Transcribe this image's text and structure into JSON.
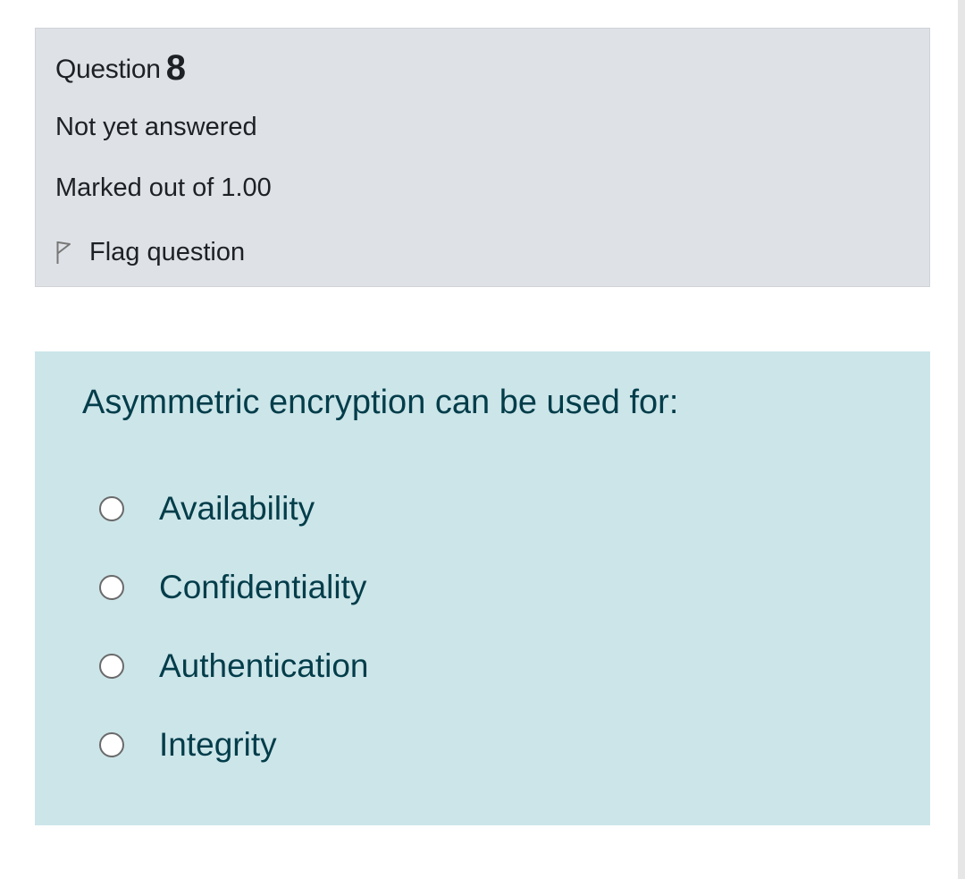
{
  "question_info": {
    "label": "Question",
    "number": "8",
    "state": "Not yet answered",
    "grade": "Marked out of 1.00",
    "flag_label": "Flag question"
  },
  "question": {
    "text": "Asymmetric encryption can be used for:",
    "answers": [
      {
        "label": "Availability",
        "selected": false
      },
      {
        "label": "Confidentiality",
        "selected": false
      },
      {
        "label": "Authentication",
        "selected": false
      },
      {
        "label": "Integrity",
        "selected": false
      }
    ]
  },
  "colors": {
    "info_background": "#dee2e6",
    "content_background": "#cce5e9",
    "content_text": "#033d4a"
  },
  "icons": {
    "flag": "flag-outline-icon",
    "radio": "radio-unchecked-icon"
  }
}
